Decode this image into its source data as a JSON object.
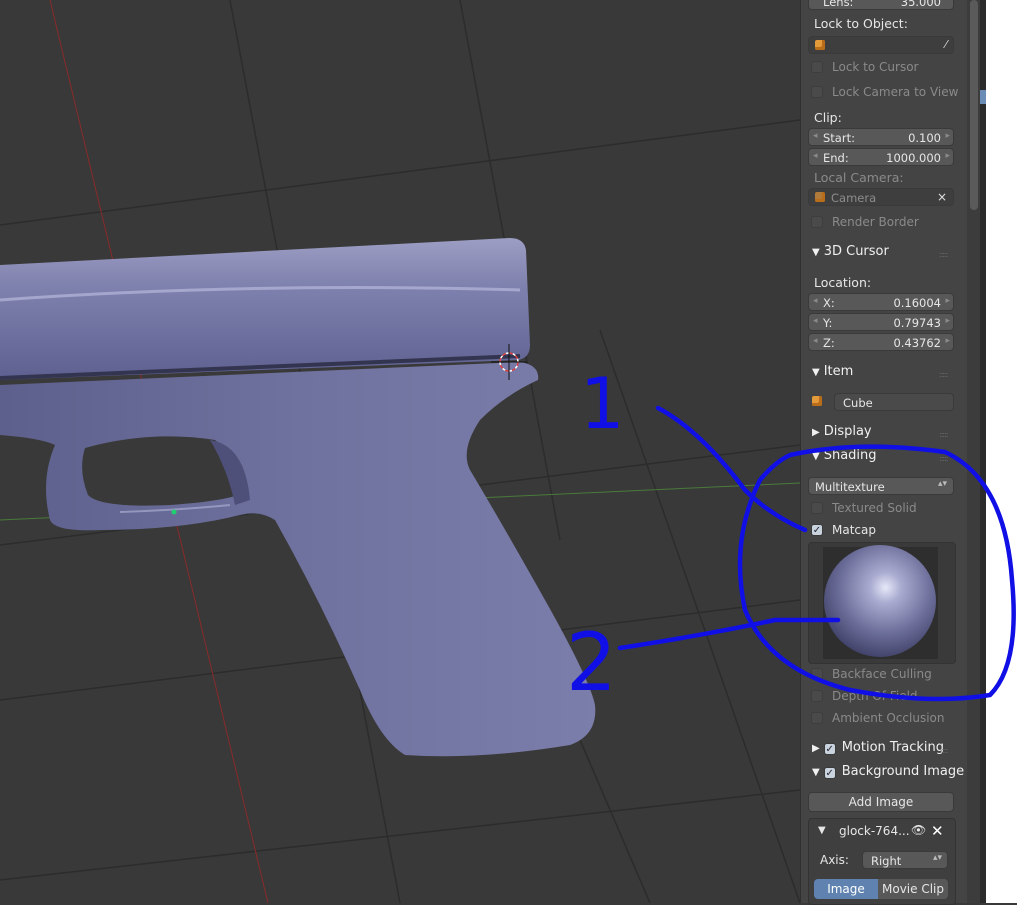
{
  "camera": {
    "lens_label": "Lens:",
    "lens_value": "35.000",
    "lock_to_object_label": "Lock to Object:",
    "lock_to_cursor_label": "Lock to Cursor",
    "lock_camera_to_view_label": "Lock Camera to View",
    "clip_label": "Clip:",
    "clip_start_label": "Start:",
    "clip_start_value": "0.100",
    "clip_end_label": "End:",
    "clip_end_value": "1000.000",
    "local_camera_label": "Local Camera:",
    "local_camera_value": "Camera",
    "render_border_label": "Render Border"
  },
  "cursor3d": {
    "title": "3D Cursor",
    "location_label": "Location:",
    "x_label": "X:",
    "x_value": "0.16004",
    "y_label": "Y:",
    "y_value": "0.79743",
    "z_label": "Z:",
    "z_value": "0.43762"
  },
  "item": {
    "title": "Item",
    "name": "Cube"
  },
  "display": {
    "title": "Display"
  },
  "shading": {
    "title": "Shading",
    "mode": "Multitexture",
    "textured_solid_label": "Textured Solid",
    "matcap_label": "Matcap",
    "backface_culling_label": "Backface Culling",
    "depth_of_field_label": "Depth Of Field",
    "ambient_occlusion_label": "Ambient Occlusion"
  },
  "motion_tracking": {
    "title": "Motion Tracking"
  },
  "background_image": {
    "title": "Background Image",
    "add_image_label": "Add Image",
    "image_name": "glock-764...",
    "axis_label": "Axis:",
    "axis_value": "Right",
    "tab_image": "Image",
    "tab_movie_clip": "Movie Clip"
  },
  "annotations": {
    "one": "1",
    "two": "2"
  },
  "colors": {
    "viewport_bg": "#393939",
    "gun": "#6d6f9a",
    "annotation": "#1010e6",
    "panel_bg": "#444444",
    "accent": "#5f82b0"
  }
}
